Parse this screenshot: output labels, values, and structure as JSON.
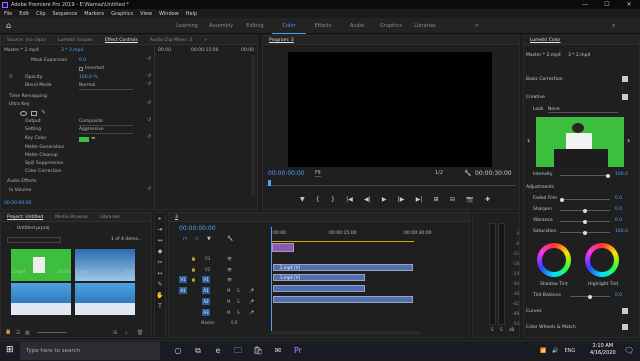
{
  "window": {
    "title": "Adobe Premiere Pro 2019 - E:\\Namaz\\Untitled *",
    "min": "—",
    "max": "☐",
    "close": "✕"
  },
  "menu": [
    "File",
    "Edit",
    "Clip",
    "Sequence",
    "Markers",
    "Graphics",
    "View",
    "Window",
    "Help"
  ],
  "workspaces": [
    "Learning",
    "Assembly",
    "Editing",
    "Color",
    "Effects",
    "Audio",
    "Graphics",
    "Libraries"
  ],
  "workspace_more": "»",
  "source_tabs": [
    "Source: (no clips)",
    "Lumetri Scopes",
    "Effect Controls",
    "Audio Clip Mixer: 3"
  ],
  "source_tabs_more": "»",
  "effect_controls": {
    "clip": "Master * 2.mp4",
    "seq": "3 * 2.mp4",
    "time_start": "00:00",
    "time_mid": "00:00:15:00",
    "time_end": "00:00",
    "rows": [
      {
        "label": "Mask Expansion",
        "value": "0.0"
      },
      {
        "label": "Inverted",
        "value": ""
      },
      {
        "label": "Opacity",
        "value": "100.0 %"
      },
      {
        "label": "Blend Mode",
        "value": "Normal"
      },
      {
        "label": "Time Remapping",
        "value": ""
      },
      {
        "label": "Ultra Key",
        "value": ""
      },
      {
        "label": "Output",
        "value": "Composite"
      },
      {
        "label": "Setting",
        "value": "Aggressive"
      },
      {
        "label": "Key Color",
        "value": ""
      },
      {
        "label": "Matte Generation",
        "value": ""
      },
      {
        "label": "Matte Cleanup",
        "value": ""
      },
      {
        "label": "Spill Suppression",
        "value": ""
      },
      {
        "label": "Color Correction",
        "value": ""
      },
      {
        "label": "Audio Effects",
        "value": ""
      },
      {
        "label": "fx Volume",
        "value": ""
      }
    ],
    "timecode": "00:00:00:00"
  },
  "program": {
    "tab": "Program: 3",
    "timecode": "00:00:00:00",
    "fit": "Fit",
    "fraction": "1/2",
    "duration": "00:00:30:00",
    "controls": [
      "▼",
      "{",
      "}",
      "|◀",
      "◀|",
      "▶",
      "|▶",
      "▶|",
      "⊞",
      "⊟",
      "📷",
      "✚"
    ]
  },
  "lumetri": {
    "tab": "Lumetri Color",
    "master": "Master * 2.mp4",
    "seq": "3 * 2.mp4",
    "sections": [
      "Basic Correction",
      "Creative",
      "Adjustments"
    ],
    "look_label": "Look",
    "look_value": "None",
    "intensity_label": "Intensity",
    "intensity_value": "100.0",
    "intensity_level": 1.0,
    "adjust": [
      {
        "label": "Faded Film",
        "value": "0.0",
        "level": 0.0
      },
      {
        "label": "Sharpen",
        "value": "0.0",
        "level": 0.5
      },
      {
        "label": "Vibrance",
        "value": "0.0",
        "level": 0.5
      },
      {
        "label": "Saturation",
        "value": "100.0",
        "level": 0.5
      }
    ],
    "shadow_tint": "Shadow Tint",
    "highlight_tint": "Highlight Tint",
    "tint_balance_label": "Tint Balance",
    "tint_balance_value": "0.0",
    "bottom": [
      "Curves",
      "Color Wheels & Match"
    ]
  },
  "project": {
    "tabs": [
      "Project: Untitled",
      "Media Browser",
      "Libraries"
    ],
    "file": "Untitled.prproj",
    "count": "1 of 4 items...",
    "items": [
      {
        "name": "2.mp4",
        "dur": "30:00"
      },
      {
        "name": "1.jpg",
        "dur": "4:29"
      },
      {
        "name": "",
        "dur": ""
      },
      {
        "name": "",
        "dur": ""
      }
    ]
  },
  "tools": [
    "▸",
    "⇥",
    "↔",
    "◆",
    "✂",
    "↤",
    "✎",
    "✋",
    "T"
  ],
  "timeline": {
    "tab": "3",
    "timecode": "00:00:00:00",
    "ruler": [
      "00:00",
      "00:00:15:00",
      "00:00:30:00"
    ],
    "video_tracks": [
      "V3",
      "V2",
      "V1"
    ],
    "audio_tracks": [
      "A1",
      "A2",
      "A3"
    ],
    "master_label": "Master",
    "master_value": "0.0",
    "clips": [
      {
        "label": "2.mp4 [V]"
      },
      {
        "label": "1.mp4 [V]"
      },
      {
        "label": ""
      },
      {
        "label": ""
      }
    ]
  },
  "meter_scale": [
    "0",
    "-6",
    "-12",
    "-18",
    "-24",
    "-30",
    "-36",
    "-42",
    "-48",
    "-54"
  ],
  "meter_bottom": [
    "S",
    "S"
  ],
  "meter_db": "dB",
  "taskbar": {
    "search": "Type here to search",
    "tray": "ENG",
    "time": "2:10 AM",
    "date": "4/16/2020",
    "icons": [
      "○",
      "⧉",
      "e",
      "🗀",
      "🛍",
      "✉",
      "Pr"
    ]
  },
  "colors": {
    "accent": "#4ea1ff",
    "clip_blue": "#4e6fb3",
    "clip_purple": "#8a5ba8",
    "green_screen": "#3cbf3c"
  }
}
